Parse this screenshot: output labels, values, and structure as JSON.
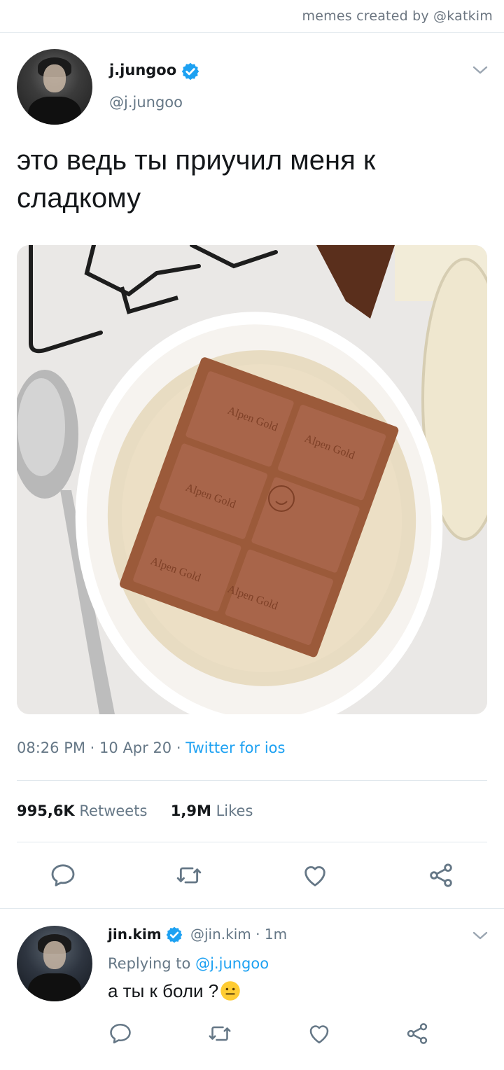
{
  "credit": "memes created by @katkim",
  "tweet": {
    "display_name": "j.jungoo",
    "handle": "@j.jungoo",
    "text": "это ведь ты приучил меня к сладкому",
    "time": "08:26 PM",
    "date": "10 Apr 20",
    "separator": "·",
    "source": "Twitter for ios",
    "retweets_count": "995,6K",
    "retweets_label": "Retweets",
    "likes_count": "1,9M",
    "likes_label": "Likes",
    "image_label": "Alpen Gold"
  },
  "reply": {
    "display_name": "jin.kim",
    "handle": "@jin.kim",
    "time": "1m",
    "replying_prefix": "Replying to",
    "replying_handle": "@j.jungoo",
    "text": "а ты к боли ?"
  },
  "colors": {
    "accent": "#1da1f2",
    "muted": "#657786",
    "text": "#14171a",
    "divider": "#e1e8ed"
  },
  "icons": [
    "verified-badge-icon",
    "chevron-down-icon",
    "reply-icon",
    "retweet-icon",
    "like-icon",
    "share-icon",
    "neutral-face-emoji"
  ]
}
